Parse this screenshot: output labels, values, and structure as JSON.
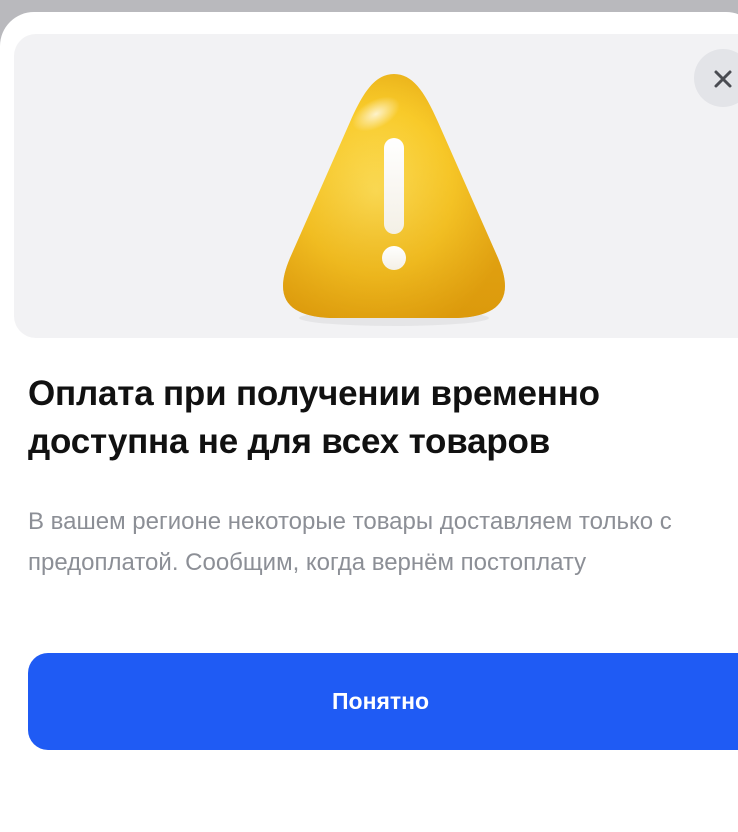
{
  "dialog": {
    "title": "Оплата при получении временно доступна не для всех товаров",
    "description": "В вашем регионе некоторые товары доставляем только с предоплатой. Сообщим, когда вернём постоплату",
    "primary_button_label": "Понятно",
    "hero_icon": "warning-triangle-icon",
    "close_icon": "close-icon"
  },
  "colors": {
    "accent": "#1F5BF4",
    "warning": "#F5C518",
    "hero_background": "#F2F2F4",
    "text_primary": "#111111",
    "text_secondary": "#8C8F96"
  }
}
